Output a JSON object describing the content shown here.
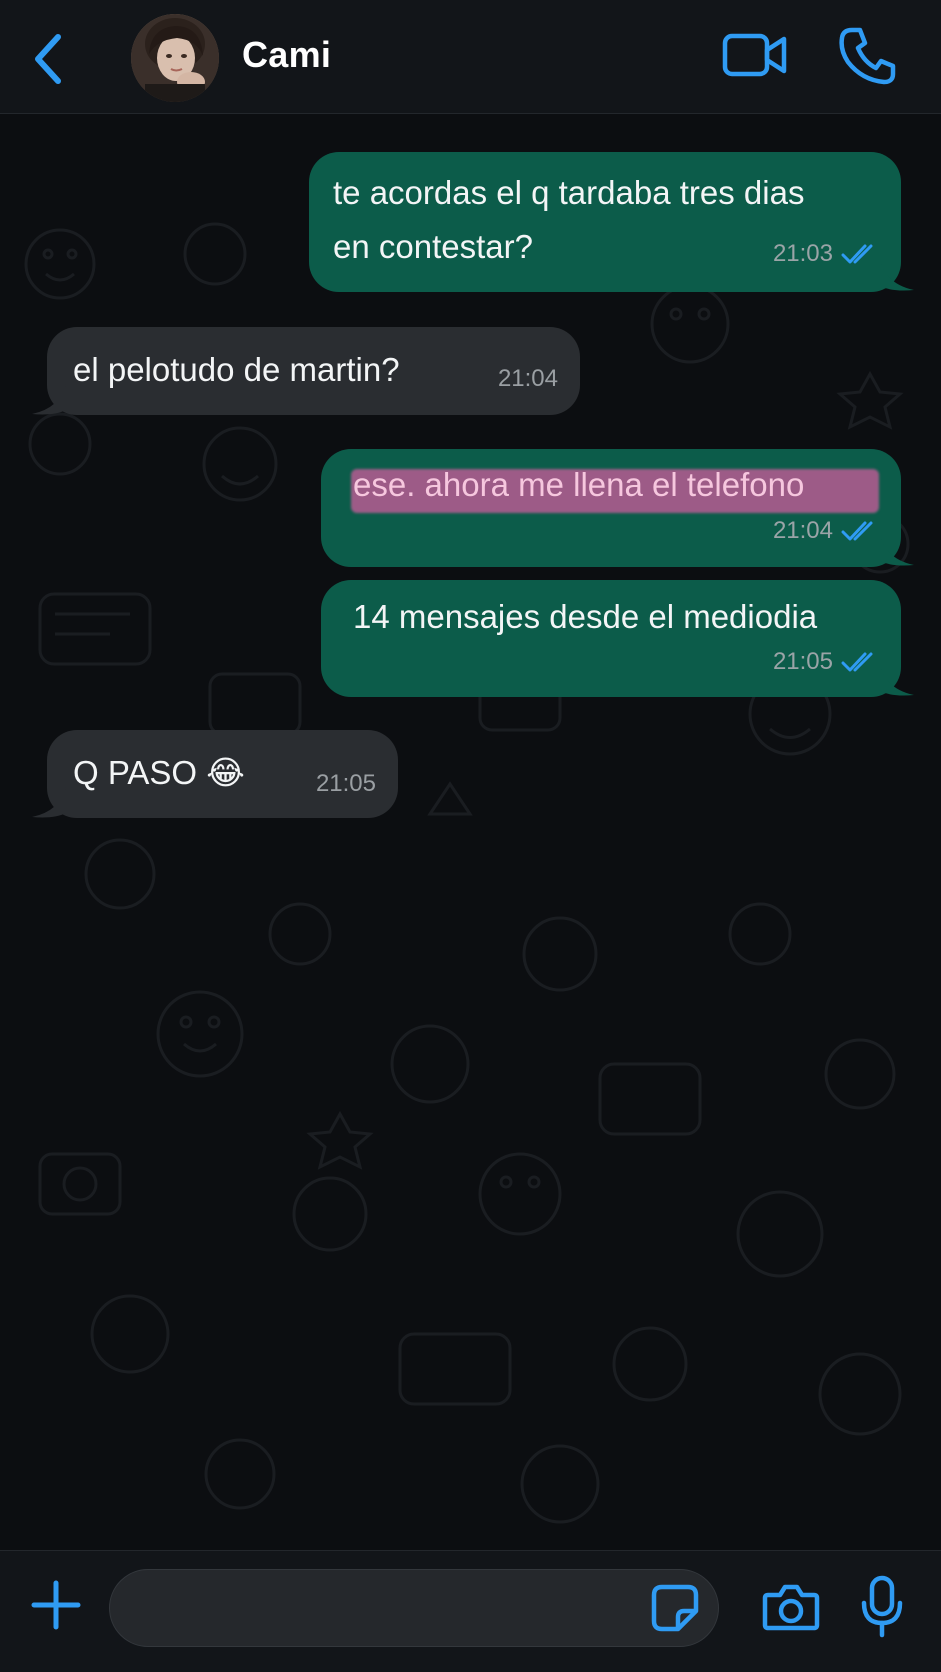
{
  "header": {
    "contact_name": "Cami",
    "back_icon": "chevron-left-icon",
    "video_icon": "video-camera-icon",
    "call_icon": "phone-icon"
  },
  "colors": {
    "accent": "#2f9bf3",
    "outgoing_bubble": "#0c5c4a",
    "incoming_bubble": "#2a2d31",
    "highlight": "#d65ca0",
    "read_ticks": "#2f9bf3"
  },
  "messages": [
    {
      "direction": "out",
      "text_line1": "te acordas el q tardaba tres dias",
      "text_line2": "en contestar?",
      "time": "21:03",
      "status": "read"
    },
    {
      "direction": "in",
      "text": "el pelotudo de martin?",
      "time": "21:04"
    },
    {
      "direction": "out",
      "text": "ese. ahora me llena el telefono",
      "time": "21:04",
      "status": "read",
      "highlighted": true
    },
    {
      "direction": "out",
      "text": "14 mensajes desde el mediodia",
      "time": "21:05",
      "status": "read"
    },
    {
      "direction": "in",
      "text": "Q PASO 😂",
      "time": "21:05"
    }
  ],
  "footer": {
    "plus_icon": "plus-icon",
    "message_input_value": "",
    "sticker_icon": "sticker-icon",
    "camera_icon": "camera-icon",
    "mic_icon": "microphone-icon"
  }
}
